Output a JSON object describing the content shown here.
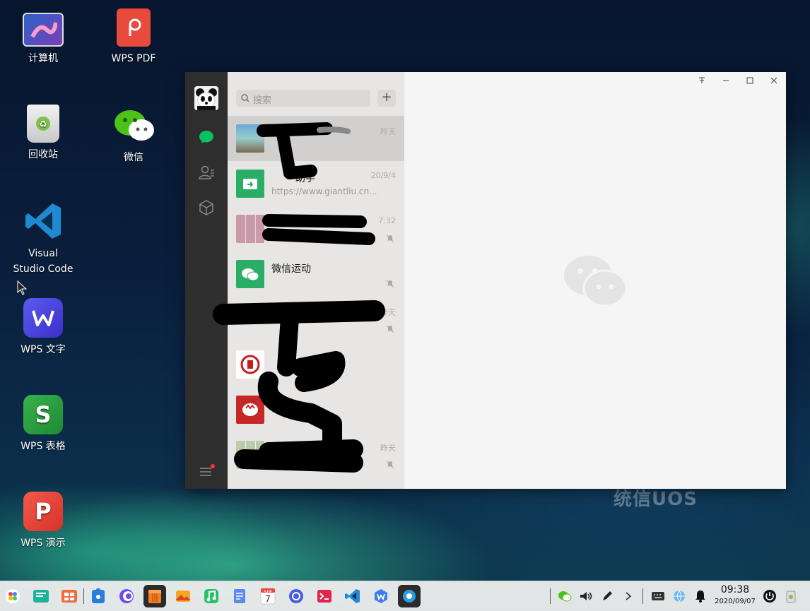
{
  "desktop": {
    "icons": [
      {
        "label": "计算机"
      },
      {
        "label": "WPS PDF"
      },
      {
        "label": "回收站"
      },
      {
        "label": "微信"
      },
      {
        "label_line1": "Visual",
        "label_line2": "Studio Code"
      },
      {
        "label": "WPS 文字"
      },
      {
        "label": "WPS 表格"
      },
      {
        "label": "WPS 演示"
      }
    ],
    "watermark": "统信UOS"
  },
  "wechat": {
    "search_placeholder": "搜索",
    "add_label": "+",
    "chats": [
      {
        "name": "",
        "preview": "",
        "time": "昨天",
        "selected": true
      },
      {
        "name": "助手",
        "preview": "https://www.giantliu.cn...",
        "time": "20/9/4"
      },
      {
        "name": "",
        "preview": "",
        "time": "7:32",
        "muted": true
      },
      {
        "name": "微信运动",
        "preview": "",
        "time": "",
        "muted": true
      },
      {
        "name": "",
        "preview": "",
        "time": "昨天",
        "muted": true
      },
      {
        "name": "",
        "preview": "",
        "time": ""
      },
      {
        "name": "",
        "preview": "",
        "time": ""
      },
      {
        "name": "",
        "preview": "",
        "time": "昨天",
        "muted": true
      }
    ],
    "window_controls": [
      "pin",
      "minimize",
      "maximize",
      "close"
    ]
  },
  "taskbar": {
    "clock_time": "09:38",
    "clock_date": "2020/09/07",
    "calendar_day": "7",
    "calendar_month": "SEP"
  },
  "colors": {
    "wechat_green": "#07c160",
    "wps_red": "#e84a3c",
    "taskbar_bg": "#eeeeee"
  }
}
